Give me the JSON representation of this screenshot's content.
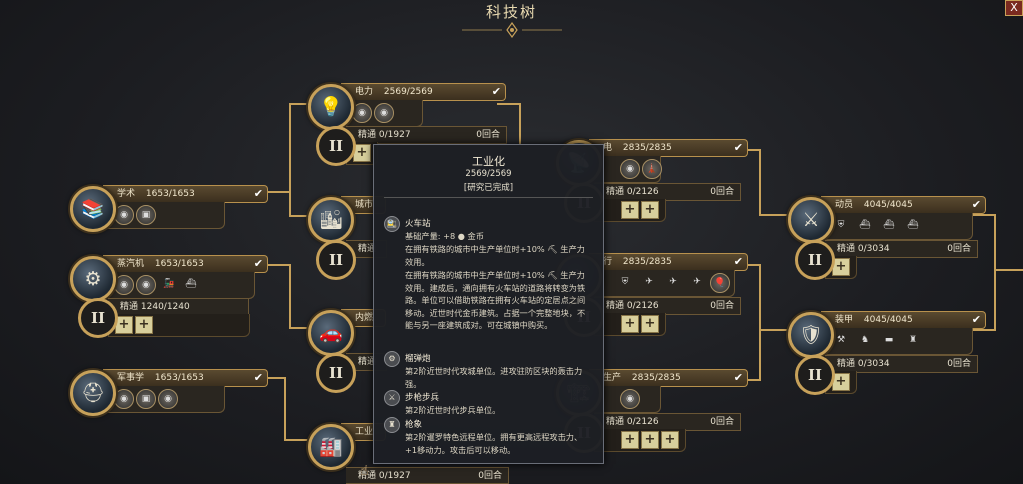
{
  "window": {
    "title": "科技树",
    "close_label": "X"
  },
  "nodes": {
    "xueshu": {
      "name": "学术",
      "progress": "1653/1653",
      "glyph": "📚",
      "icon": "books-icon"
    },
    "zhengqiji": {
      "name": "蒸汽机",
      "progress": "1653/1653",
      "glyph": "⚙",
      "icon": "steam-engine-icon",
      "mastery": {
        "roman": "II",
        "label": "精通",
        "progress": "1240/1240",
        "turns": ""
      }
    },
    "junshixue": {
      "name": "军事学",
      "progress": "1653/1653",
      "glyph": "⛑",
      "icon": "helmet-icon"
    },
    "dianli": {
      "name": "电力",
      "progress": "2569/2569",
      "glyph": "💡",
      "icon": "lightbulb-icon",
      "mastery": {
        "roman": "II",
        "label": "精通",
        "progress": "0/1927",
        "turns": "0回合"
      }
    },
    "chengshi": {
      "name": "城市",
      "progress": "",
      "glyph": "🏙",
      "icon": "city-icon",
      "mastery": {
        "roman": "II",
        "label": "精通",
        "progress": "",
        "turns": ""
      }
    },
    "neiran": {
      "name": "内燃",
      "progress": "",
      "glyph": "🚗",
      "icon": "engine-icon",
      "mastery": {
        "roman": "II",
        "label": "精通",
        "progress": "",
        "turns": ""
      }
    },
    "gongye": {
      "name": "工业",
      "progress": "",
      "glyph": "🏭",
      "icon": "factory-icon",
      "mastery": {
        "label": "精通",
        "progress": "0/1927",
        "turns": "0回合"
      }
    },
    "dian": {
      "name": "电",
      "progress": "2835/2835",
      "glyph": "📡",
      "icon": "radio-icon",
      "mastery": {
        "roman": "II",
        "label": "精通",
        "progress": "0/2126",
        "turns": "0回合"
      }
    },
    "mid2": {
      "name": "行",
      "progress": "2835/2835",
      "glyph": "✈",
      "icon": "flight-icon",
      "mastery": {
        "roman": "II",
        "label": "精通",
        "progress": "0/2126",
        "turns": "0回合"
      }
    },
    "mid3": {
      "name": "生产",
      "progress": "2835/2835",
      "glyph": "🏗",
      "icon": "mass-production-icon",
      "mastery": {
        "roman": "II",
        "label": "精通",
        "progress": "0/2126",
        "turns": "0回合"
      }
    },
    "dongyuan": {
      "name": "动员",
      "progress": "4045/4045",
      "glyph": "⚔",
      "icon": "mobilization-icon",
      "mastery": {
        "roman": "II",
        "label": "精通",
        "progress": "0/3034",
        "turns": "0回合"
      }
    },
    "zhuangjia": {
      "name": "装甲",
      "progress": "4045/4045",
      "glyph": "🛡",
      "icon": "armor-icon",
      "mastery": {
        "roman": "II",
        "label": "精通",
        "progress": "0/3034",
        "turns": "0回合"
      }
    }
  },
  "tooltip": {
    "title": "工业化",
    "progress": "2569/2569",
    "status": "[研究已完成]",
    "items": [
      {
        "name": "火车站",
        "icon": "train-station-icon",
        "lines": [
          "基础产量: +8 ● 金币",
          "在拥有铁路的城市中生产单位时+10% ⛏ 生产力效用。",
          "在拥有铁路的城市中生产单位时+10% ⛏ 生产力效用。建成后，通向拥有火车站的道路将转变为铁路。单位可以借助铁路在拥有火车站的定居点之间移动。近世时代金币建筑。占据一个完整地块，不能与另一座建筑成对。可在城镇中购买。"
        ]
      },
      {
        "name": "榴弹炮",
        "icon": "howitzer-icon",
        "lines": [
          "第2阶近世时代攻城单位。进攻驻防区块的轰击力强。"
        ]
      },
      {
        "name": "步枪步兵",
        "icon": "rifleman-icon",
        "lines": [
          "第2阶近世时代步兵单位。"
        ]
      },
      {
        "name": "枪象",
        "icon": "gun-elephant-icon",
        "lines": [
          "第2阶暹罗特色远程单位。拥有更高远程攻击力、+1移动力。攻击后可以移动。"
        ]
      }
    ]
  },
  "colors": {
    "accent_gold": "#c7a15a",
    "background": "#1c1d21",
    "tooltip_bg": "#1d1f24"
  }
}
